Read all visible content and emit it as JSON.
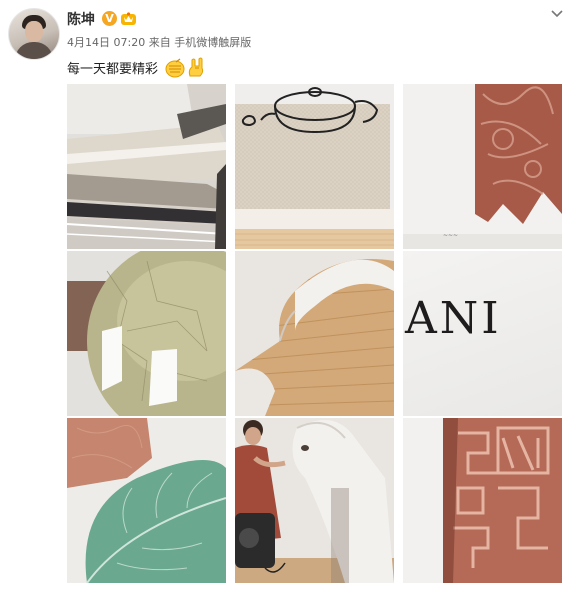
{
  "post": {
    "user": {
      "name": "陈坤",
      "verified_badge": "V",
      "member_icon": "crown-member-icon"
    },
    "meta": {
      "date": "4月14日",
      "time": "07:20",
      "source_prefix": "来自",
      "source": "手机微博触屏版"
    },
    "text": "每一天都要精彩",
    "emoji": [
      "fist-emoji",
      "rock-hand-emoji"
    ],
    "photos": [
      {
        "name": "photo-stacked-papers"
      },
      {
        "name": "photo-teapot-sketch-box"
      },
      {
        "name": "photo-red-seal-print"
      },
      {
        "name": "photo-green-crackle-vase"
      },
      {
        "name": "photo-white-ceramic-on-wood"
      },
      {
        "name": "photo-ani-lettering",
        "text": "ANI"
      },
      {
        "name": "photo-green-leaf"
      },
      {
        "name": "photo-boy-and-horse-statue"
      },
      {
        "name": "photo-red-seal-stamp"
      }
    ]
  },
  "colors": {
    "verified": "#f5a623",
    "text": "#222222",
    "meta": "#666666"
  }
}
